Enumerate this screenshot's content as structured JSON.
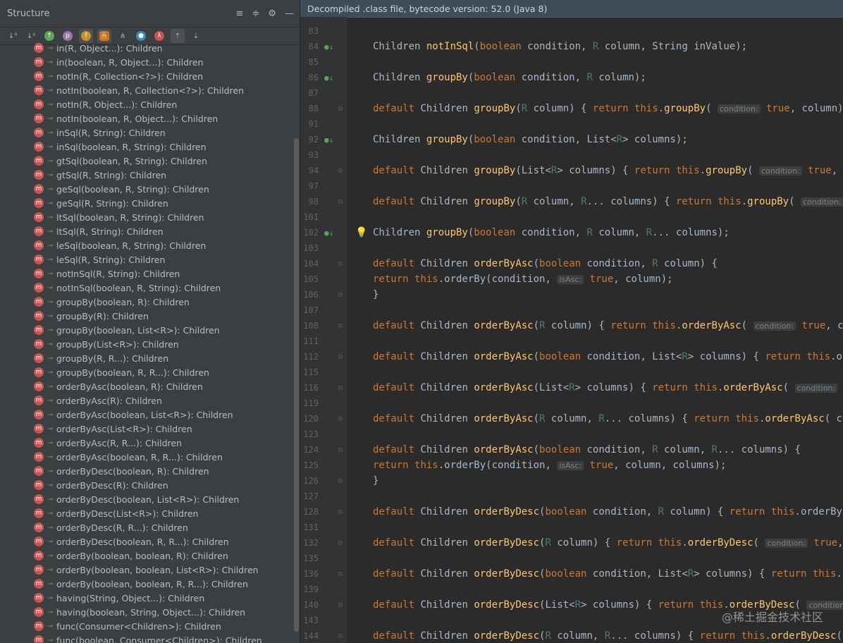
{
  "structure": {
    "title": "Structure",
    "items": [
      "in(R, Object...): Children",
      "in(boolean, R, Object...): Children",
      "notIn(R, Collection<?>): Children",
      "notIn(boolean, R, Collection<?>): Children",
      "notIn(R, Object...): Children",
      "notIn(boolean, R, Object...): Children",
      "inSql(R, String): Children",
      "inSql(boolean, R, String): Children",
      "gtSql(boolean, R, String): Children",
      "gtSql(R, String): Children",
      "geSql(boolean, R, String): Children",
      "geSql(R, String): Children",
      "ltSql(boolean, R, String): Children",
      "ltSql(R, String): Children",
      "leSql(boolean, R, String): Children",
      "leSql(R, String): Children",
      "notInSql(R, String): Children",
      "notInSql(boolean, R, String): Children",
      "groupBy(boolean, R): Children",
      "groupBy(R): Children",
      "groupBy(boolean, List<R>): Children",
      "groupBy(List<R>): Children",
      "groupBy(R, R...): Children",
      "groupBy(boolean, R, R...): Children",
      "orderByAsc(boolean, R): Children",
      "orderByAsc(R): Children",
      "orderByAsc(boolean, List<R>): Children",
      "orderByAsc(List<R>): Children",
      "orderByAsc(R, R...): Children",
      "orderByAsc(boolean, R, R...): Children",
      "orderByDesc(boolean, R): Children",
      "orderByDesc(R): Children",
      "orderByDesc(boolean, List<R>): Children",
      "orderByDesc(List<R>): Children",
      "orderByDesc(R, R...): Children",
      "orderByDesc(boolean, R, R...): Children",
      "orderBy(boolean, boolean, R): Children",
      "orderBy(boolean, boolean, List<R>): Children",
      "orderBy(boolean, boolean, R, R...): Children",
      "having(String, Object...): Children",
      "having(boolean, String, Object...): Children",
      "func(Consumer<Children>): Children",
      "func(boolean, Consumer<Children>): Children"
    ]
  },
  "editor": {
    "banner": "Decompiled .class file, bytecode version: 52.0 (Java 8)",
    "lines": [
      {
        "n": "83",
        "text": ""
      },
      {
        "n": "84",
        "text": "Children notInSql(boolean condition, R column, String inValue);"
      },
      {
        "n": "85",
        "text": ""
      },
      {
        "n": "86",
        "text": "Children groupBy(boolean condition, R column);"
      },
      {
        "n": "87",
        "text": ""
      },
      {
        "n": "88",
        "text": "default Children groupBy(R column) { return this.groupBy( condition: true, column); }"
      },
      {
        "n": "91",
        "text": ""
      },
      {
        "n": "92",
        "text": "Children groupBy(boolean condition, List<R> columns);"
      },
      {
        "n": "93",
        "text": ""
      },
      {
        "n": "94",
        "text": "default Children groupBy(List<R> columns) { return this.groupBy( condition: true, colum"
      },
      {
        "n": "97",
        "text": ""
      },
      {
        "n": "98",
        "text": "default Children groupBy(R column, R... columns) { return this.groupBy( condition: true"
      },
      {
        "n": "101",
        "text": ""
      },
      {
        "n": "102",
        "text": "Children groupBy(boolean condition, R column, R... columns);"
      },
      {
        "n": "103",
        "text": ""
      },
      {
        "n": "104",
        "text": "default Children orderByAsc(boolean condition, R column) {"
      },
      {
        "n": "105",
        "text": "    return this.orderBy(condition,  isAsc: true, column);"
      },
      {
        "n": "106",
        "text": "}"
      },
      {
        "n": "107",
        "text": ""
      },
      {
        "n": "108",
        "text": "default Children orderByAsc(R column) { return this.orderByAsc( condition: true, column"
      },
      {
        "n": "111",
        "text": ""
      },
      {
        "n": "112",
        "text": "default Children orderByAsc(boolean condition, List<R> columns) { return this.orderBy"
      },
      {
        "n": "115",
        "text": ""
      },
      {
        "n": "116",
        "text": "default Children orderByAsc(List<R> columns) { return this.orderByAsc( condition: true,"
      },
      {
        "n": "119",
        "text": ""
      },
      {
        "n": "120",
        "text": "default Children orderByAsc(R column, R... columns) { return this.orderByAsc( conditi"
      },
      {
        "n": "123",
        "text": ""
      },
      {
        "n": "124",
        "text": "default Children orderByAsc(boolean condition, R column, R... columns) {"
      },
      {
        "n": "125",
        "text": "    return this.orderBy(condition,  isAsc: true, column, columns);"
      },
      {
        "n": "126",
        "text": "}"
      },
      {
        "n": "127",
        "text": ""
      },
      {
        "n": "128",
        "text": "default Children orderByDesc(boolean condition, R column) { return this.orderBy(cond"
      },
      {
        "n": "131",
        "text": ""
      },
      {
        "n": "132",
        "text": "default Children orderByDesc(R column) { return this.orderByDesc( condition: true, colu"
      },
      {
        "n": "135",
        "text": ""
      },
      {
        "n": "136",
        "text": "default Children orderByDesc(boolean condition, List<R> columns) { return this.order"
      },
      {
        "n": "139",
        "text": ""
      },
      {
        "n": "140",
        "text": "default Children orderByDesc(List<R> columns) { return this.orderByDesc( condition: tru"
      },
      {
        "n": "143",
        "text": ""
      },
      {
        "n": "144",
        "text": "default Children orderByDesc(R column, R... columns) { return this.orderByDesc( cond"
      }
    ]
  },
  "watermark": "@稀土掘金技术社区"
}
